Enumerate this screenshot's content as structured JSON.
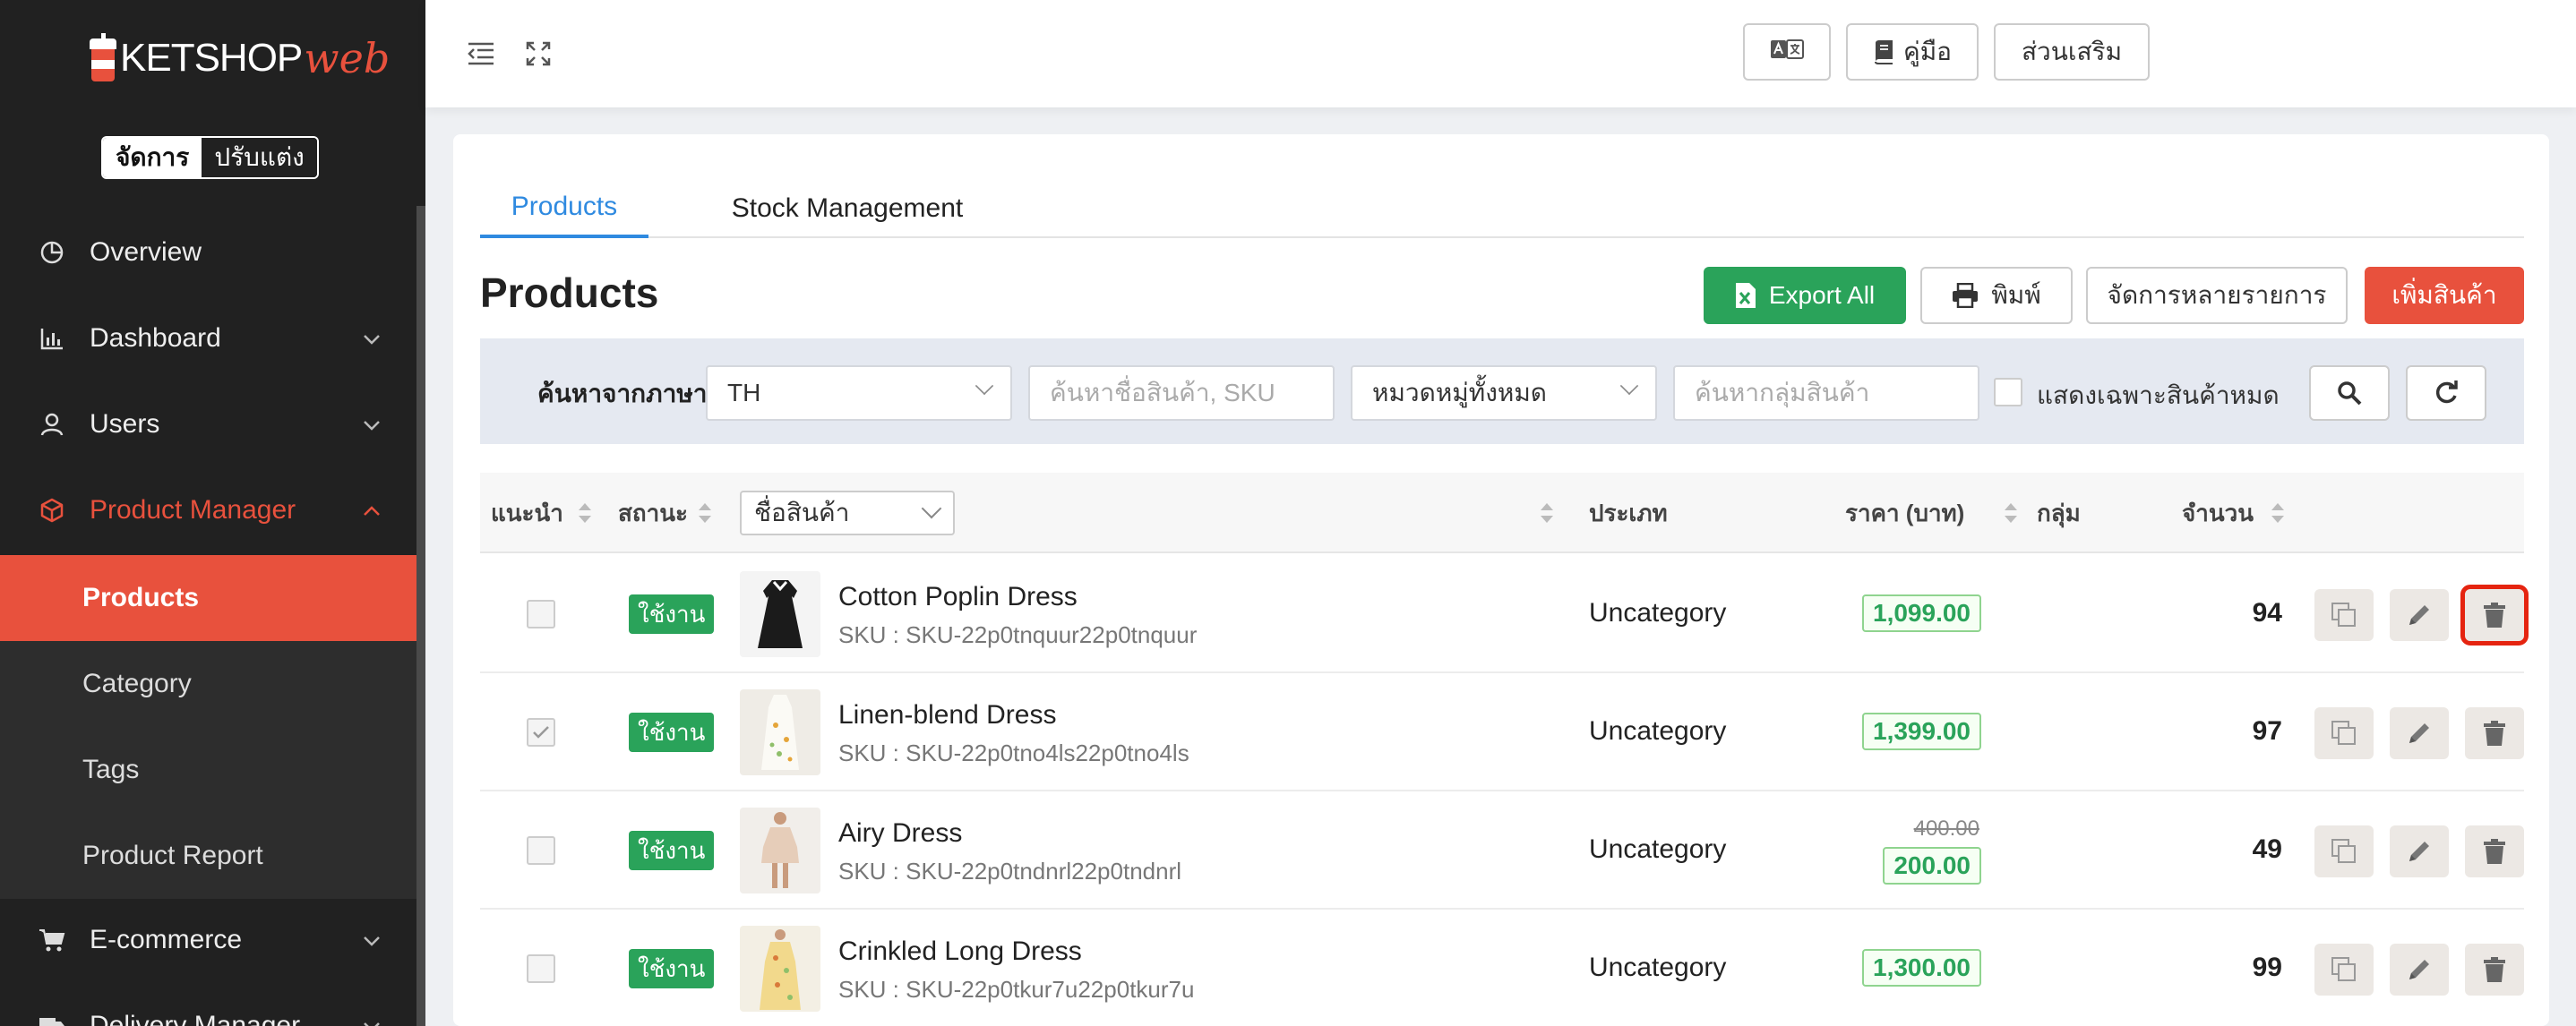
{
  "brand": {
    "name": "KETSHOP",
    "suffix": "web"
  },
  "mode": {
    "manage": "จัดการ",
    "customize": "ปรับแต่ง"
  },
  "nav": {
    "overview": "Overview",
    "dashboard": "Dashboard",
    "users": "Users",
    "product_manager": "Product Manager",
    "ecommerce": "E-commerce",
    "delivery": "Delivery Manager"
  },
  "subnav": {
    "products": "Products",
    "category": "Category",
    "tags": "Tags",
    "report": "Product Report"
  },
  "topbar": {
    "manual": "คู่มือ",
    "addons": "ส่วนเสริม"
  },
  "tabs": {
    "products": "Products",
    "stock": "Stock Management"
  },
  "page_title": "Products",
  "actions": {
    "export": "Export All",
    "print": "พิมพ์",
    "bulk": "จัดการหลายรายการ",
    "add": "เพิ่มสินค้า"
  },
  "filter": {
    "lang_label": "ค้นหาจากภาษา",
    "lang_value": "TH",
    "search_placeholder": "ค้นหาชื่อสินค้า, SKU",
    "category_value": "หมวดหมู่ทั้งหมด",
    "group_placeholder": "ค้นหากลุ่มสินค้า",
    "out_of_stock_label": "แสดงเฉพาะสินค้าหมด"
  },
  "columns": {
    "recommend": "แนะนำ",
    "status": "สถานะ",
    "name": "ชื่อสินค้า",
    "type": "ประเภท",
    "price": "ราคา (บาท)",
    "group": "กลุ่ม",
    "qty": "จำนวน"
  },
  "rows": [
    {
      "checked": false,
      "status": "ใช้งาน",
      "name": "Cotton Poplin Dress",
      "sku": "SKU : SKU-22p0tnquur22p0tnquur",
      "type": "Uncategory",
      "price": "1,099.00",
      "old_price": "",
      "qty": "94",
      "thumb": "black-dress"
    },
    {
      "checked": true,
      "status": "ใช้งาน",
      "name": "Linen-blend Dress",
      "sku": "SKU : SKU-22p0tno4ls22p0tno4ls",
      "type": "Uncategory",
      "price": "1,399.00",
      "old_price": "",
      "qty": "97",
      "thumb": "floral-white-dress"
    },
    {
      "checked": false,
      "status": "ใช้งาน",
      "name": "Airy Dress",
      "sku": "SKU : SKU-22p0tndnrl22p0tndnrl",
      "type": "Uncategory",
      "price": "200.00",
      "old_price": "400.00",
      "qty": "49",
      "thumb": "beige-dress"
    },
    {
      "checked": false,
      "status": "ใช้งาน",
      "name": "Crinkled Long Dress",
      "sku": "SKU : SKU-22p0tkur7u22p0tkur7u",
      "type": "Uncategory",
      "price": "1,300.00",
      "old_price": "",
      "qty": "99",
      "thumb": "yellow-floral-dress"
    }
  ],
  "colors": {
    "accent": "#e8513d",
    "link": "#2f8ae0",
    "green": "#2aa35a",
    "sidebar": "#212121",
    "highlight": "#e52410"
  }
}
